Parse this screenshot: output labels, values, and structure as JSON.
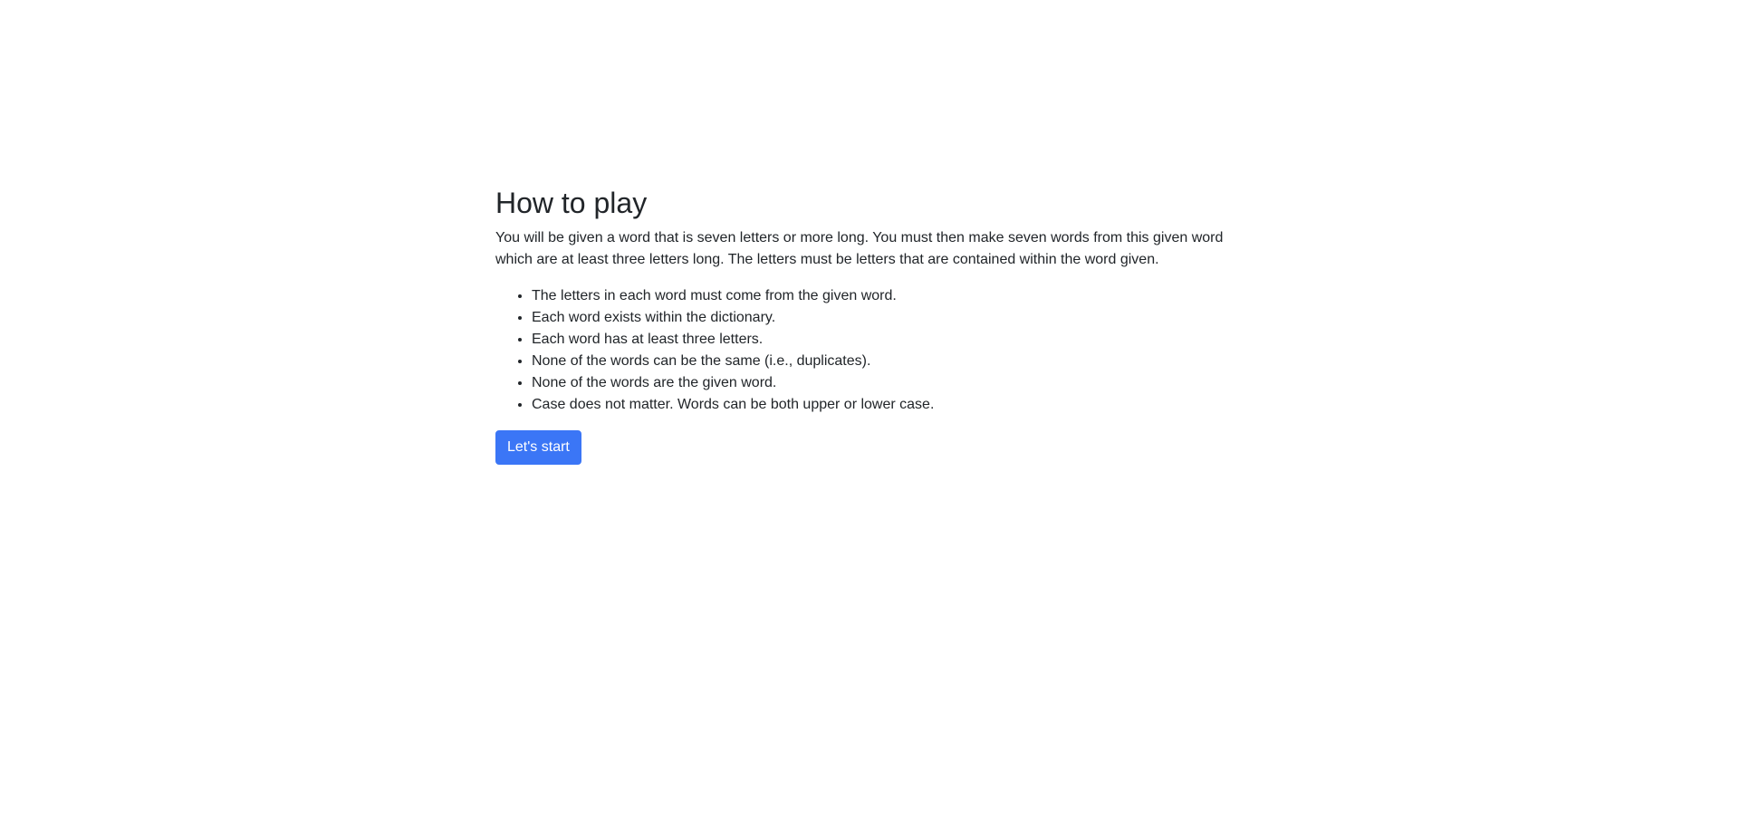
{
  "page": {
    "title": "How to play",
    "intro": "You will be given a word that is seven letters or more long. You must then make seven words from this given word which are at least three letters long. The letters must be letters that are contained within the word given.",
    "rules": [
      "The letters in each word must come from the given word.",
      "Each word exists within the dictionary.",
      "Each word has at least three letters.",
      "None of the words can be the same (i.e., duplicates).",
      "None of the words are the given word.",
      "Case does not matter. Words can be both upper or lower case."
    ],
    "start_button_label": "Let's start"
  },
  "colors": {
    "accent": "#3b76f6",
    "text": "#212529",
    "background": "#ffffff"
  }
}
